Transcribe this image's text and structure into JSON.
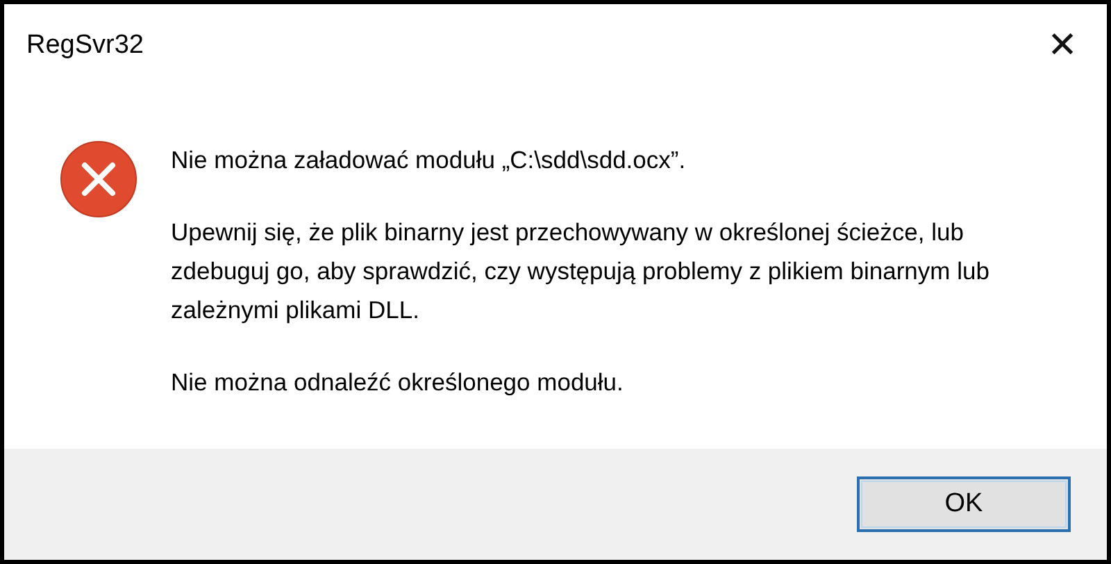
{
  "window": {
    "title": "RegSvr32",
    "close": "✕"
  },
  "messages": [
    "Nie można załadować modułu „C:\\sdd\\sdd.ocx”.",
    "Upewnij się, że plik binarny jest przechowywany w określonej ścieżce, lub zdebuguj go, aby sprawdzić, czy występują problemy z plikiem binarnym lub zależnymi plikami DLL.",
    "Nie można odnaleźć określonego modułu."
  ],
  "buttons": [
    "OK"
  ]
}
